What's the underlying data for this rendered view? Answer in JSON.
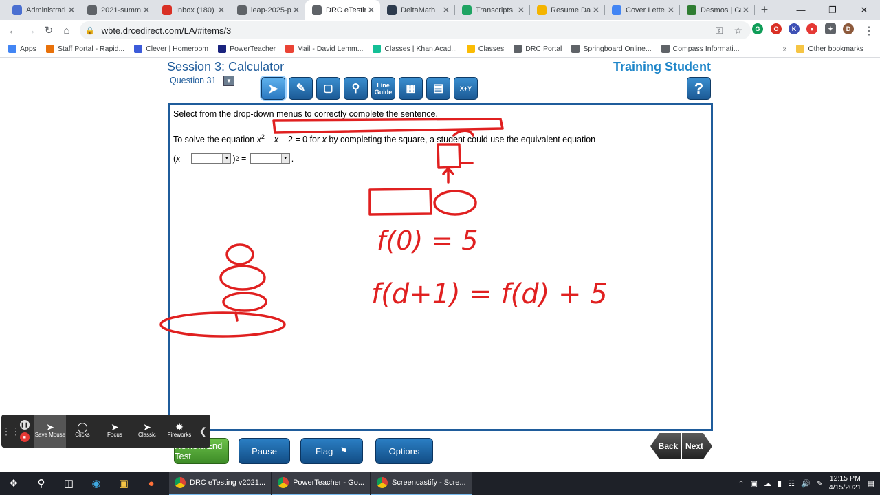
{
  "browser": {
    "tabs": [
      {
        "title": "Administrati",
        "icon": "chromebook-icon",
        "color": "#4a6fd1"
      },
      {
        "title": "2021-summ",
        "icon": "globe-icon",
        "color": "#5f6368"
      },
      {
        "title": "Inbox (180)",
        "icon": "gmail-icon",
        "color": "#d93025"
      },
      {
        "title": "leap-2025-p",
        "icon": "globe-icon",
        "color": "#5f6368"
      },
      {
        "title": "DRC eTesting",
        "icon": "globe-icon",
        "color": "#5f6368"
      },
      {
        "title": "DeltaMath",
        "icon": "deltamath-icon",
        "color": "#2d3b4e"
      },
      {
        "title": "Transcripts",
        "icon": "drive-icon",
        "color": "#1fa463"
      },
      {
        "title": "Resume Dav",
        "icon": "slides-icon",
        "color": "#f4b400"
      },
      {
        "title": "Cover Lette",
        "icon": "docs-icon",
        "color": "#4285f4"
      },
      {
        "title": "Desmos | Gr",
        "icon": "desmos-icon",
        "color": "#2f7d32"
      }
    ],
    "active_tab": 4,
    "url": "wbte.drcedirect.com/LA/#items/3",
    "bookmarks": [
      "Apps",
      "Staff Portal - Rapid...",
      "Clever | Homeroom",
      "PowerTeacher",
      "Mail - David Lemm...",
      "Classes | Khan Acad...",
      "Classes",
      "DRC Portal",
      "Springboard Online...",
      "Compass Informati..."
    ],
    "bookmarks_more": "»",
    "other_bookmarks": "Other bookmarks"
  },
  "test": {
    "session_title": "Session 3: Calculator",
    "question_label": "Question 31",
    "student_name": "Training Student",
    "tools": [
      {
        "name": "pointer",
        "label": ""
      },
      {
        "name": "highlighter",
        "label": ""
      },
      {
        "name": "eraser",
        "label": ""
      },
      {
        "name": "magnifier",
        "label": ""
      },
      {
        "name": "line-guide",
        "label": "Line Guide"
      },
      {
        "name": "calculator",
        "label": ""
      },
      {
        "name": "graph",
        "label": ""
      },
      {
        "name": "formula",
        "label": "X+Y"
      }
    ],
    "help_label": "?",
    "prompt": "Select from the drop-down menus to correctly complete the sentence.",
    "stem_before": "To solve the equation ",
    "stem_var": "x",
    "stem_exp": "2",
    "stem_mid": " – ",
    "stem_var2": "x",
    "stem_rest": " – 2 = 0 for ",
    "stem_var3": "x",
    "stem_end": " by completing the square, a student could use the equivalent equation",
    "eq_open": "(",
    "eq_var": "x",
    "eq_minus": " – ",
    "eq_close": ")",
    "eq_exp": "2",
    "eq_equals": " = ",
    "eq_period": ".",
    "ink_f0": "f(0) = 5",
    "ink_recursion": "f(d+1) = f(d) + 5",
    "buttons": {
      "review": "Review/End Test",
      "pause": "Pause",
      "flag": "Flag",
      "options": "Options",
      "back": "Back",
      "next": "Next"
    }
  },
  "screencastify": {
    "buttons": [
      {
        "label": "Save Mouse",
        "icon": "cursor-icon"
      },
      {
        "label": "Clicks",
        "icon": "click-ring-icon"
      },
      {
        "label": "Focus",
        "icon": "cursor-icon"
      },
      {
        "label": "Classic",
        "icon": "cursor-icon"
      },
      {
        "label": "Fireworks",
        "icon": "fireworks-icon"
      }
    ]
  },
  "taskbar": {
    "apps": [
      "DRC eTesting v2021...",
      "PowerTeacher - Go...",
      "Screencastify - Scre..."
    ],
    "time": "12:15 PM",
    "date": "4/15/2021"
  },
  "colors": {
    "accent": "#1f5c9b",
    "ink": "#e02020",
    "student": "#1f86c9"
  }
}
